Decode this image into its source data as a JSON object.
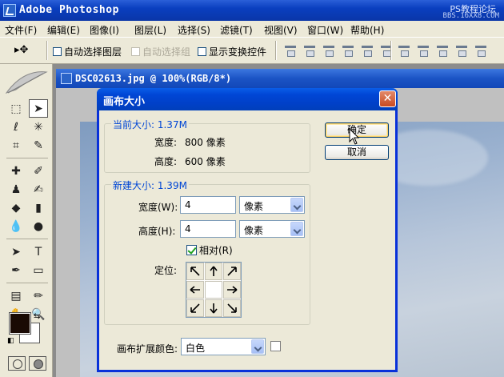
{
  "app": {
    "title": "Adobe Photoshop",
    "watermark_line1": "PS教程论坛",
    "watermark_line2": "BBS.16XX8.COM"
  },
  "menu": [
    "文件(F)",
    "编辑(E)",
    "图像(I)",
    "图层(L)",
    "选择(S)",
    "滤镜(T)",
    "视图(V)",
    "窗口(W)",
    "帮助(H)"
  ],
  "options_bar": {
    "move_tool": "▸✥",
    "auto_select_layer": "自动选择图层",
    "auto_select_group": "自动选择组",
    "show_transform": "显示变换控件"
  },
  "document": {
    "title": "DSC02613.jpg @ 100%(RGB/8*)"
  },
  "dialog": {
    "title": "画布大小",
    "close": "✕",
    "current_size": {
      "legend": "当前大小: 1.37M",
      "width_label": "宽度:",
      "width_value": "800 像素",
      "height_label": "高度:",
      "height_value": "600 像素"
    },
    "new_size": {
      "legend": "新建大小: 1.39M",
      "width_label": "宽度(W):",
      "width_value": "4",
      "width_unit": "像素",
      "height_label": "高度(H):",
      "height_value": "4",
      "height_unit": "像素",
      "relative_label": "相对(R)",
      "anchor_label": "定位:"
    },
    "extension_color_label": "画布扩展颜色:",
    "extension_color_value": "白色",
    "ok": "确定",
    "cancel": "取消"
  },
  "colors": {
    "foreground": "#1a0a04",
    "background": "#ffffff",
    "accent": "#0046d5"
  }
}
